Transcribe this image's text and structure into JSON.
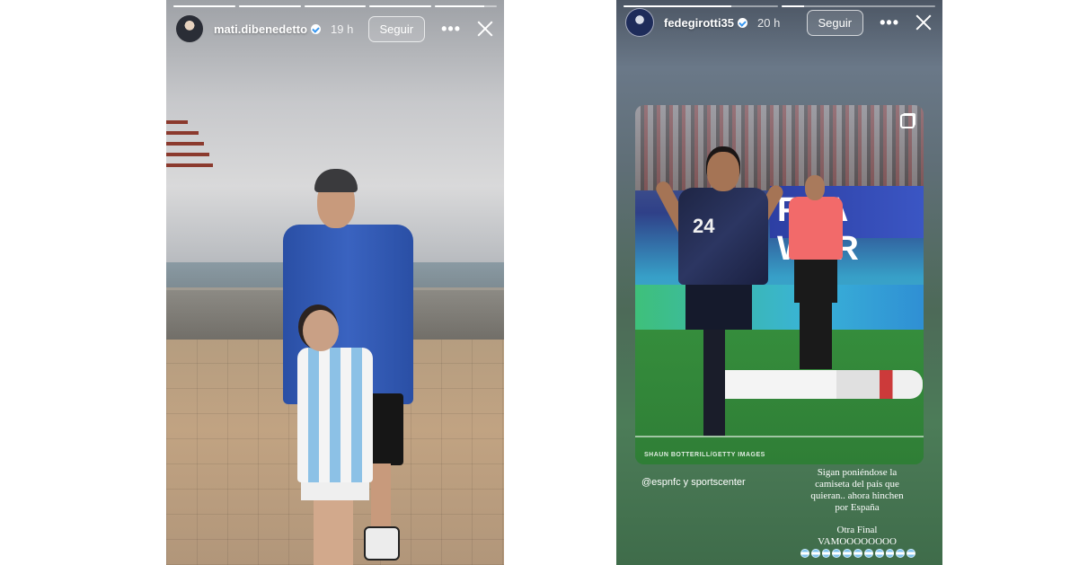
{
  "stories": [
    {
      "username": "mati.dibenedetto",
      "time": "19 h",
      "follow_label": "Seguir",
      "more_icon": "more-horizontal-icon",
      "close_icon": "close-icon",
      "progress": [
        1,
        1,
        1,
        1,
        0.8
      ]
    },
    {
      "username": "fedegirotti35",
      "time": "20 h",
      "follow_label": "Seguir",
      "more_icon": "more-horizontal-icon",
      "close_icon": "close-icon",
      "progress": [
        0.7,
        0.15
      ],
      "photo_credit": "SHAUN BOTTERILL/GETTY IMAGES",
      "photo_banner_text": "FIFA WOR",
      "player_number": "24",
      "mention_text": "@espnfc y sportscenter",
      "caption_lines": [
        "Sigan poniéndose la",
        "camiseta del país que",
        "quieran.. ahora hinchen",
        "por España"
      ],
      "caption_footer": [
        "Otra Final",
        "VAMOOOOOOOO"
      ],
      "emoji_icon": "argentina-flag-emoji-icon",
      "emoji_count": 11
    }
  ],
  "colors": {
    "verified": "#3897f0"
  }
}
